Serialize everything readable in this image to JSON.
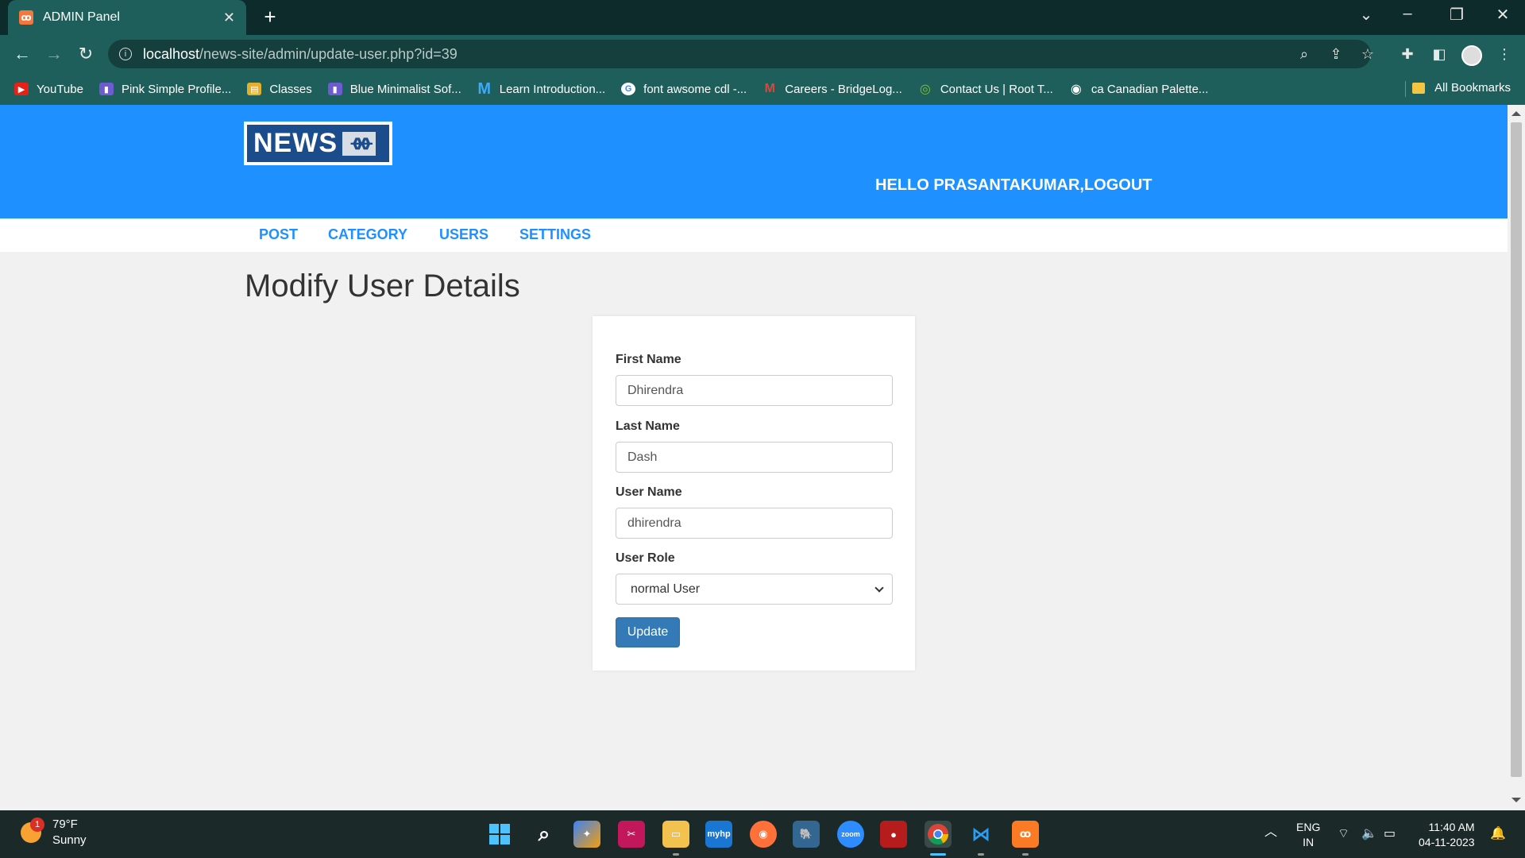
{
  "browser": {
    "tab_title": "ADMIN Panel",
    "tab_close": "✕",
    "new_tab": "+",
    "url_host": "localhost",
    "url_path": "/news-site/admin/update-user.php?id=39",
    "bookmarks": [
      {
        "label": "YouTube",
        "color": "#e62117",
        "glyph": "▶"
      },
      {
        "label": "Pink Simple Profile...",
        "color": "#6d5bd0",
        "glyph": "▮"
      },
      {
        "label": "Classes",
        "color": "#e1b12c",
        "glyph": "▤"
      },
      {
        "label": "Blue Minimalist Sof...",
        "color": "#6d5bd0",
        "glyph": "▮"
      },
      {
        "label": "Learn Introduction...",
        "color": "#1f7fd6",
        "glyph": "M"
      },
      {
        "label": "font awsome cdl -...",
        "color": "#ffffff",
        "glyph": "G"
      },
      {
        "label": "Careers - BridgeLog...",
        "color": "#d9473d",
        "glyph": "M"
      },
      {
        "label": "Contact Us | Root T...",
        "color": "#7bbf3a",
        "glyph": "◎"
      },
      {
        "label": "ca Canadian Palette...",
        "color": "#ffffff",
        "glyph": "◉"
      }
    ],
    "all_bookmarks": "All Bookmarks"
  },
  "site": {
    "logo_text": "NEWS",
    "logo_mark": "ᚖᚖ",
    "greeting": "HELLO PRASANTAKUMAR,LOGOUT",
    "menu": [
      "POST",
      "CATEGORY",
      "USERS",
      "SETTINGS"
    ]
  },
  "form": {
    "title": "Modify User Details",
    "first_name_label": "First Name",
    "first_name_value": "Dhirendra",
    "last_name_label": "Last Name",
    "last_name_value": "Dash",
    "user_name_label": "User Name",
    "user_name_value": "dhirendra",
    "role_label": "User Role",
    "role_value": "normal User",
    "submit_label": "Update"
  },
  "taskbar": {
    "temperature": "79°F",
    "condition": "Sunny",
    "weather_badge": "1",
    "language_1": "ENG",
    "language_2": "IN",
    "time": "11:40 AM",
    "date": "04-11-2023"
  }
}
